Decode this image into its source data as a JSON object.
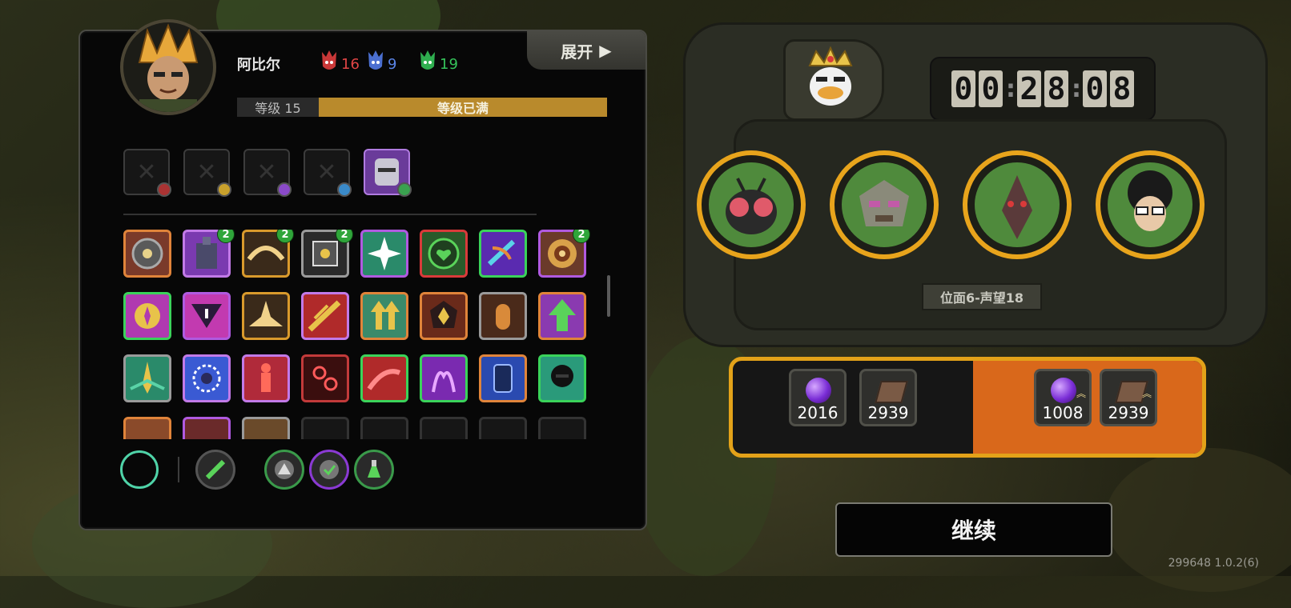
{
  "character": {
    "name": "阿比尔",
    "stats": [
      {
        "icon": "red-mask-icon",
        "value": "16",
        "color": "#e04545"
      },
      {
        "icon": "blue-mask-icon",
        "value": "9",
        "color": "#5a84e6"
      },
      {
        "icon": "green-mask-icon",
        "value": "19",
        "color": "#35c35a"
      }
    ],
    "level_label": "等级 15",
    "level_status": "等级已满",
    "expand_label": "展开",
    "level_progress": 1.0
  },
  "skills": {
    "row1_badges": [
      "",
      "2",
      "2",
      "2",
      "",
      "",
      "",
      "2"
    ]
  },
  "timer": {
    "digits": [
      "0",
      "0",
      "2",
      "8",
      "0",
      "8"
    ]
  },
  "plane_label": "位面6-声望18",
  "rewards": {
    "left": [
      {
        "icon": "purple-orb-icon",
        "value": "2016"
      },
      {
        "icon": "book-icon",
        "value": "2939"
      }
    ],
    "right": [
      {
        "icon": "purple-orb-icon",
        "value": "1008"
      },
      {
        "icon": "book-icon",
        "value": "2939"
      }
    ]
  },
  "continue_label": "继续",
  "version": "299648 1.0.2(6)",
  "colors": {
    "accent_gold": "#e3a219",
    "level_bar": "#b98a2c",
    "reward_highlight": "#d9681b"
  }
}
